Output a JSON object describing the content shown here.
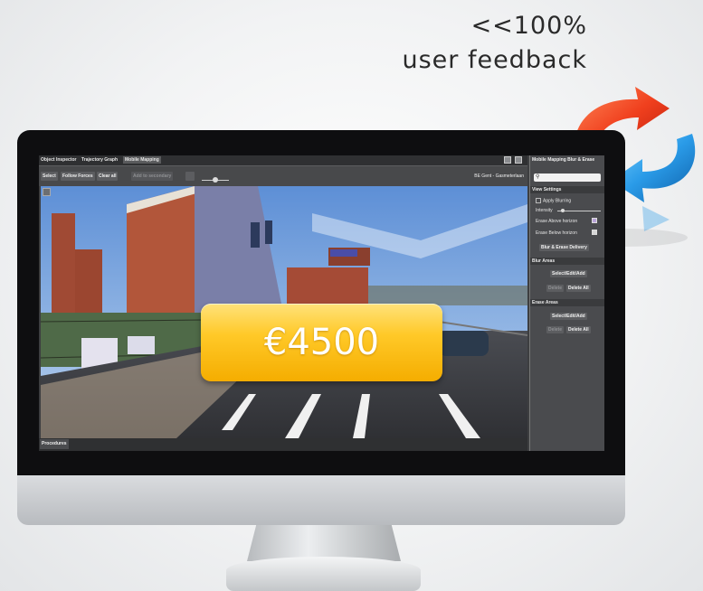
{
  "headline": {
    "line1": "<<100%",
    "line2": "user feedback"
  },
  "app": {
    "tabs": [
      "Object Inspector",
      "Trajectory Graph",
      "Mobile Mapping"
    ],
    "toolbar": {
      "select": "Select",
      "follow_forces": "Follow Forces",
      "clear_all": "Clear all",
      "add_to_secondary": "Add to secondary",
      "location": "BE Gent - Gasmeterlaan"
    },
    "procedures_label": "Procedures",
    "right_panel": {
      "title": "Mobile Mapping Blur & Erase",
      "view_settings": "View Settings",
      "apply_blurring": "Apply Blurring",
      "intensity": "Intensity",
      "erase_above": "Erase Above horizon",
      "erase_below": "Erase Below horizon",
      "blur_erase_delivery": "Blur & Erase Delivery",
      "blur_areas": "Blur Areas",
      "erase_areas": "Erase Areas",
      "select_edit_add": "Select/Edit/Add",
      "delete": "Delete",
      "delete_all": "Delete All",
      "swatch_color": "#b9a3d8"
    }
  },
  "price": {
    "label": "€4500",
    "color": "#ffc928"
  },
  "icons": [
    "cycle-arrows-icon",
    "search-icon",
    "pin-icon",
    "maximize-icon"
  ]
}
